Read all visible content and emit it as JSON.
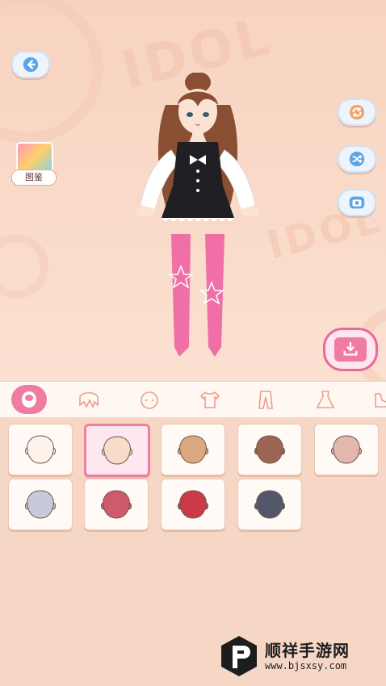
{
  "background": {
    "watermark_text": "IDOL",
    "colors": {
      "stage": "#f8d3c0",
      "accent": "#f07ca3",
      "button_blue": "#5aa5e6"
    }
  },
  "left_buttons": {
    "back_icon": "back-arrow-icon",
    "gallery_label": "图鉴"
  },
  "right_buttons": {
    "reset_icon": "refresh-icon",
    "random_icon": "shuffle-icon",
    "camera_icon": "camera-icon",
    "save_icon": "download-tray-icon"
  },
  "category_tabs": [
    {
      "name": "face",
      "icon": "face-icon",
      "active": true
    },
    {
      "name": "hair",
      "icon": "hair-icon",
      "active": false
    },
    {
      "name": "head-accessory",
      "icon": "head-icon",
      "active": false
    },
    {
      "name": "top",
      "icon": "shirt-icon",
      "active": false
    },
    {
      "name": "pants",
      "icon": "pants-icon",
      "active": false
    },
    {
      "name": "dress",
      "icon": "dress-icon",
      "active": false
    },
    {
      "name": "shoes",
      "icon": "shoe-icon",
      "active": false
    }
  ],
  "skin_tones": [
    {
      "color": "#fdf3ea",
      "selected": false
    },
    {
      "color": "#f8dcc7",
      "selected": true
    },
    {
      "color": "#dba882",
      "selected": false
    },
    {
      "color": "#9c6552",
      "selected": false
    },
    {
      "color": "#e3b7ac",
      "selected": false
    },
    {
      "color": "#c9c9dc",
      "selected": false
    },
    {
      "color": "#cf5a6a",
      "selected": false
    },
    {
      "color": "#cc3a4a",
      "selected": false
    },
    {
      "color": "#525769",
      "selected": false
    }
  ],
  "site_watermark": {
    "name": "顺祥手游网",
    "url": "www.bjsxsy.com"
  }
}
